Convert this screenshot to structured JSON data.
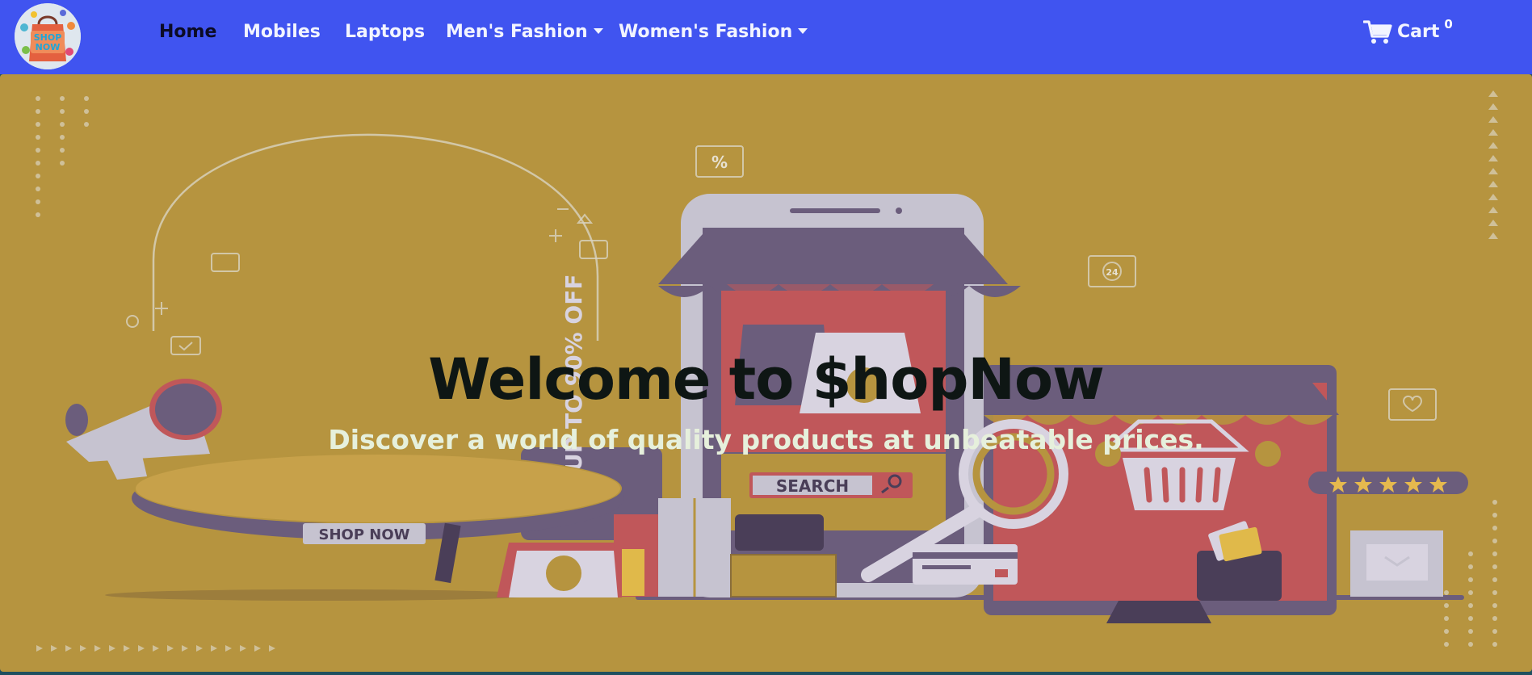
{
  "brand": {
    "logo_alt": "ShopNow logo",
    "logo_text_line1": "SHOP",
    "logo_text_line2": "NOW"
  },
  "nav": {
    "items": [
      {
        "label": "Home",
        "active": true,
        "dropdown": false
      },
      {
        "label": "Mobiles",
        "active": false,
        "dropdown": false
      },
      {
        "label": "Laptops",
        "active": false,
        "dropdown": false
      },
      {
        "label": "Men's Fashion",
        "active": false,
        "dropdown": true
      },
      {
        "label": "Women's Fashion",
        "active": false,
        "dropdown": true
      }
    ],
    "cart": {
      "label": "Cart",
      "count": "0",
      "icon": "cart-icon"
    }
  },
  "hero": {
    "title": "Welcome to $hopNow",
    "subtitle": "Discover a world of quality products at unbeatable prices.",
    "illustration": {
      "search_label": "SEARCH",
      "shop_now_label": "SHOP NOW",
      "promo_text": "UP TO 90% OFF",
      "percent_badge": "%",
      "support_badge": "24",
      "rating_stars": 5
    }
  },
  "colors": {
    "navbar": "#4054f0",
    "hero_background": "#b6943f",
    "accent_purple": "#6b5d7c",
    "accent_red": "#c0575a",
    "accent_gray": "#c9c6d3"
  }
}
